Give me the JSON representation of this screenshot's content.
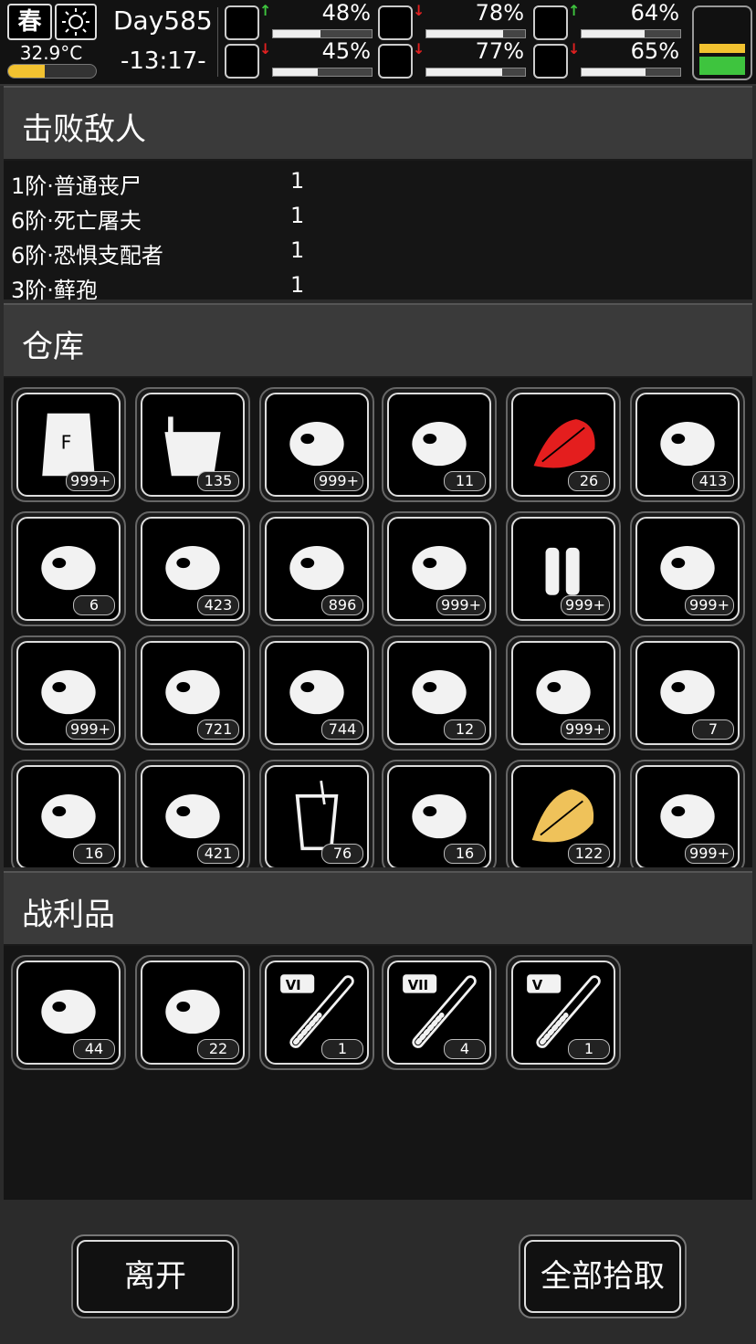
{
  "status": {
    "season": "春",
    "temperature": "32.9°C",
    "temperature_level": 0.42,
    "day": "Day585",
    "clock": "-13:17-",
    "stats": [
      {
        "name": "medical-icon",
        "pct": "48%",
        "level": 0.48,
        "trend": "up"
      },
      {
        "name": "stomach-icon",
        "pct": "78%",
        "level": 0.78,
        "trend": "down"
      },
      {
        "name": "pill-icon",
        "pct": "64%",
        "level": 0.64,
        "trend": "up"
      },
      {
        "name": "foot-icon",
        "pct": "45%",
        "level": 0.45,
        "trend": "down"
      },
      {
        "name": "water-drop-icon",
        "pct": "77%",
        "level": 0.77,
        "trend": "down"
      },
      {
        "name": "heart-icon",
        "pct": "65%",
        "level": 0.65,
        "trend": "down"
      }
    ],
    "colors": {
      "up": "#3ec43e",
      "down": "#e02020",
      "battery_yellow": "#f2c230",
      "battery_green": "#3ec43e"
    }
  },
  "sections": {
    "defeated": "击败敌人",
    "storage": "仓库",
    "loot": "战利品"
  },
  "enemies": [
    {
      "name": "1阶·普通丧尸",
      "count": "1"
    },
    {
      "name": "6阶·死亡屠夫",
      "count": "1"
    },
    {
      "name": "6阶·恐惧支配者",
      "count": "1"
    },
    {
      "name": "3阶·藓孢",
      "count": "1"
    }
  ],
  "storage": [
    {
      "icon": "flour-sack-icon",
      "count": "999+"
    },
    {
      "icon": "bucket-icon",
      "count": "135"
    },
    {
      "icon": "scrap-metal-icon",
      "count": "999+"
    },
    {
      "icon": "seeds-icon",
      "count": "11"
    },
    {
      "icon": "red-herb-icon",
      "count": "26"
    },
    {
      "icon": "bullet-tips-icon",
      "count": "413"
    },
    {
      "icon": "pills-icon",
      "count": "6"
    },
    {
      "icon": "pipes-icon",
      "count": "423"
    },
    {
      "icon": "wood-plank-icon",
      "count": "896"
    },
    {
      "icon": "cloth-icon",
      "count": "999+"
    },
    {
      "icon": "bullets-icon",
      "count": "999+"
    },
    {
      "icon": "bandage-icon",
      "count": "999+"
    },
    {
      "icon": "nuts-icon",
      "count": "999+"
    },
    {
      "icon": "casing-icon",
      "count": "721"
    },
    {
      "icon": "pellets-icon",
      "count": "744"
    },
    {
      "icon": "grain-seeds-icon",
      "count": "12"
    },
    {
      "icon": "nails-icon",
      "count": "999+"
    },
    {
      "icon": "ginger-root-icon",
      "count": "7"
    },
    {
      "icon": "wool-icon",
      "count": "16"
    },
    {
      "icon": "rope-icon",
      "count": "421"
    },
    {
      "icon": "juice-drink-icon",
      "count": "76"
    },
    {
      "icon": "beans-icon",
      "count": "16"
    },
    {
      "icon": "yellow-herb-icon",
      "count": "122"
    },
    {
      "icon": "paper-icon",
      "count": "999+"
    }
  ],
  "loot": [
    {
      "icon": "meat-icon",
      "count": "44"
    },
    {
      "icon": "folded-cloth-icon",
      "count": "22"
    },
    {
      "icon": "test-tube-vi-icon",
      "count": "1",
      "tier": "VI"
    },
    {
      "icon": "test-tube-vii-icon",
      "count": "4",
      "tier": "VII"
    },
    {
      "icon": "test-tube-v-icon",
      "count": "1",
      "tier": "V"
    }
  ],
  "buttons": {
    "leave": "离开",
    "take_all": "全部拾取"
  }
}
